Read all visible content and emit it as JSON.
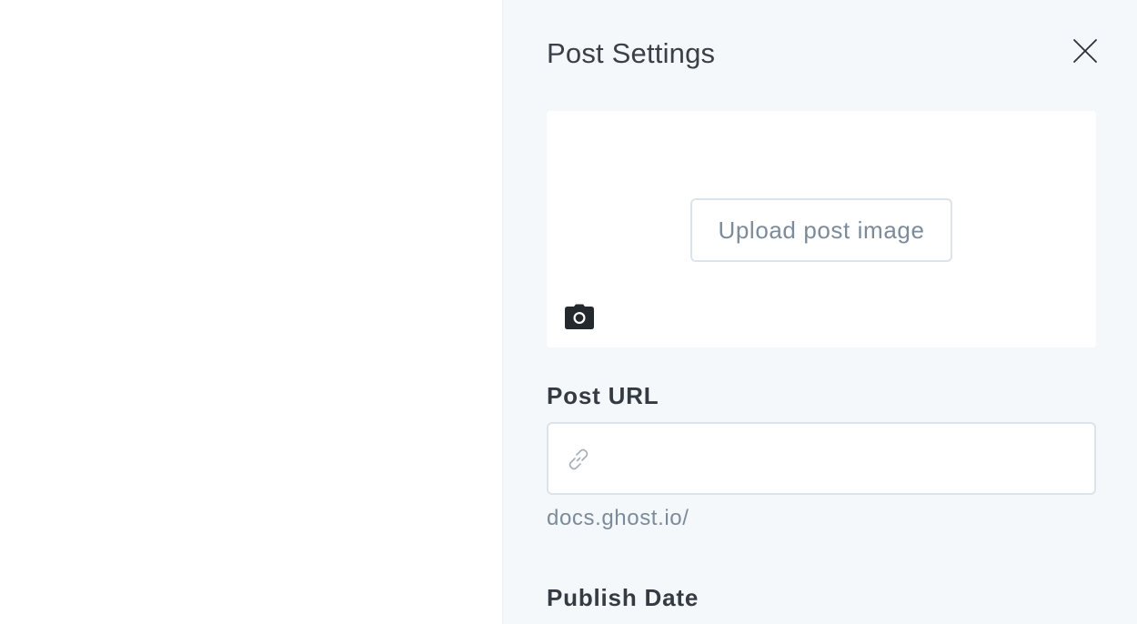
{
  "panel": {
    "title": "Post Settings",
    "close_icon": "close-icon",
    "background": "#f4f8fb"
  },
  "image_upload": {
    "button_label": "Upload post image",
    "camera_icon": "camera-icon"
  },
  "post_url": {
    "label": "Post URL",
    "value": "",
    "placeholder": "",
    "link_icon": "link-icon",
    "hint": "docs.ghost.io/"
  },
  "publish_date": {
    "label": "Publish Date"
  }
}
